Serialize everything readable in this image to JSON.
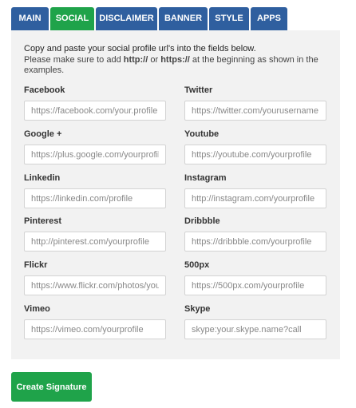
{
  "tabs": [
    {
      "label": "MAIN"
    },
    {
      "label": "SOCIAL"
    },
    {
      "label": "DISCLAIMER"
    },
    {
      "label": "BANNER"
    },
    {
      "label": "STYLE"
    },
    {
      "label": "APPS"
    }
  ],
  "active_tab": "SOCIAL",
  "intro": {
    "line1": "Copy and paste your social profile url's into the fields below.",
    "line2a": "Please make sure to add ",
    "http": "http://",
    "or": " or ",
    "https": "https://",
    "line2b": " at the beginning as shown in the",
    "line3": "examples."
  },
  "fields": {
    "facebook": {
      "label": "Facebook",
      "placeholder": "https://facebook.com/your.profile"
    },
    "twitter": {
      "label": "Twitter",
      "placeholder": "https://twitter.com/yourusername"
    },
    "google": {
      "label": "Google +",
      "placeholder": "https://plus.google.com/yourprofile"
    },
    "youtube": {
      "label": "Youtube",
      "placeholder": "https://youtube.com/yourprofile"
    },
    "linkedin": {
      "label": "Linkedin",
      "placeholder": "https://linkedin.com/profile"
    },
    "instagram": {
      "label": "Instagram",
      "placeholder": "http://instagram.com/yourprofile"
    },
    "pinterest": {
      "label": "Pinterest",
      "placeholder": "http://pinterest.com/yourprofile"
    },
    "dribbble": {
      "label": "Dribbble",
      "placeholder": "https://dribbble.com/yourprofile"
    },
    "flickr": {
      "label": "Flickr",
      "placeholder": "https://www.flickr.com/photos/yourprofile"
    },
    "px500": {
      "label": "500px",
      "placeholder": "https://500px.com/yourprofile"
    },
    "vimeo": {
      "label": "Vimeo",
      "placeholder": "https://vimeo.com/yourprofile"
    },
    "skype": {
      "label": "Skype",
      "placeholder": "skype:your.skype.name?call"
    }
  },
  "create_button": {
    "label": "Create Signature"
  },
  "colors": {
    "tab": "#2f5f9f",
    "tab_active": "#1fa34a",
    "panel": "#f2f2f2",
    "button": "#1fa34a"
  }
}
